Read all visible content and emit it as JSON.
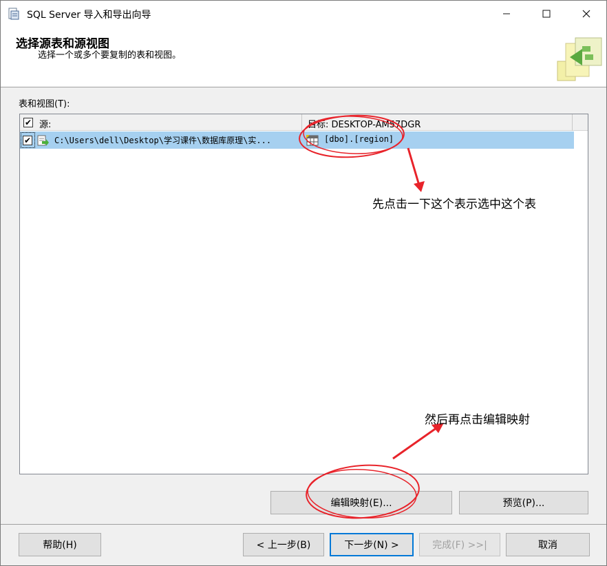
{
  "window": {
    "title": "SQL Server 导入和导出向导",
    "minimize_glyph": "—",
    "maximize_glyph": "☐",
    "close_glyph": "✕"
  },
  "header": {
    "title": "选择源表和源视图",
    "subtitle": "选择一个或多个要复制的表和视图。",
    "logo_icon": "wizard-logo-icon"
  },
  "tables_section": {
    "label": "表和视图(T):",
    "columns": {
      "source": "源:",
      "destination": "目标: DESKTOP-AM57DGR"
    },
    "header_checked": true,
    "rows": [
      {
        "checked": true,
        "source": "C:\\Users\\dell\\Desktop\\学习课件\\数据库原理\\实...",
        "destination": "[dbo].[region]",
        "selected": true
      }
    ]
  },
  "buttons": {
    "edit_mappings": "编辑映射(E)...",
    "preview": "预览(P)...",
    "help": "帮助(H)",
    "back": "< 上一步(B)",
    "next": "下一步(N) >",
    "finish": "完成(F) >>|",
    "cancel": "取消"
  },
  "annotations": {
    "note1": "先点击一下这个表示选中这个表",
    "note2": "然后再点击编辑映射",
    "color": "#e8232a"
  },
  "colors": {
    "selection": "#a6d0f0",
    "focus_button_border": "#0078d7",
    "annotation": "#e8232a"
  }
}
